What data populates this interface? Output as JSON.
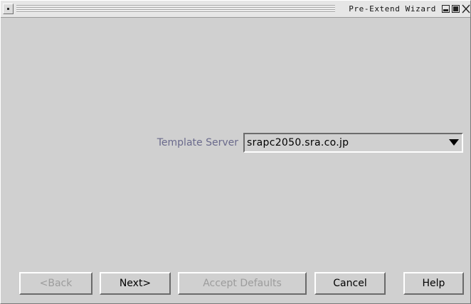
{
  "window": {
    "title": "Pre-Extend Wizard"
  },
  "form": {
    "template_server": {
      "label": "Template Server",
      "value": "srapc2050.sra.co.jp"
    }
  },
  "buttons": {
    "back": {
      "label": "<Back",
      "enabled": false
    },
    "next": {
      "label": "Next>",
      "enabled": true
    },
    "accept_defaults": {
      "label": "Accept Defaults",
      "enabled": false
    },
    "cancel": {
      "label": "Cancel",
      "enabled": true
    },
    "help": {
      "label": "Help",
      "enabled": true
    }
  },
  "icons": {
    "window_menu": "window-menu-icon",
    "minimize": "minimize-icon",
    "maximize": "maximize-icon",
    "close": "close-icon",
    "dropdown": "triangle-down-icon"
  },
  "colors": {
    "background": "#d0d0d0",
    "label_text": "#6a6a8c",
    "disabled_text": "#9c9c9c",
    "titlebar": "#e6e6e6"
  }
}
